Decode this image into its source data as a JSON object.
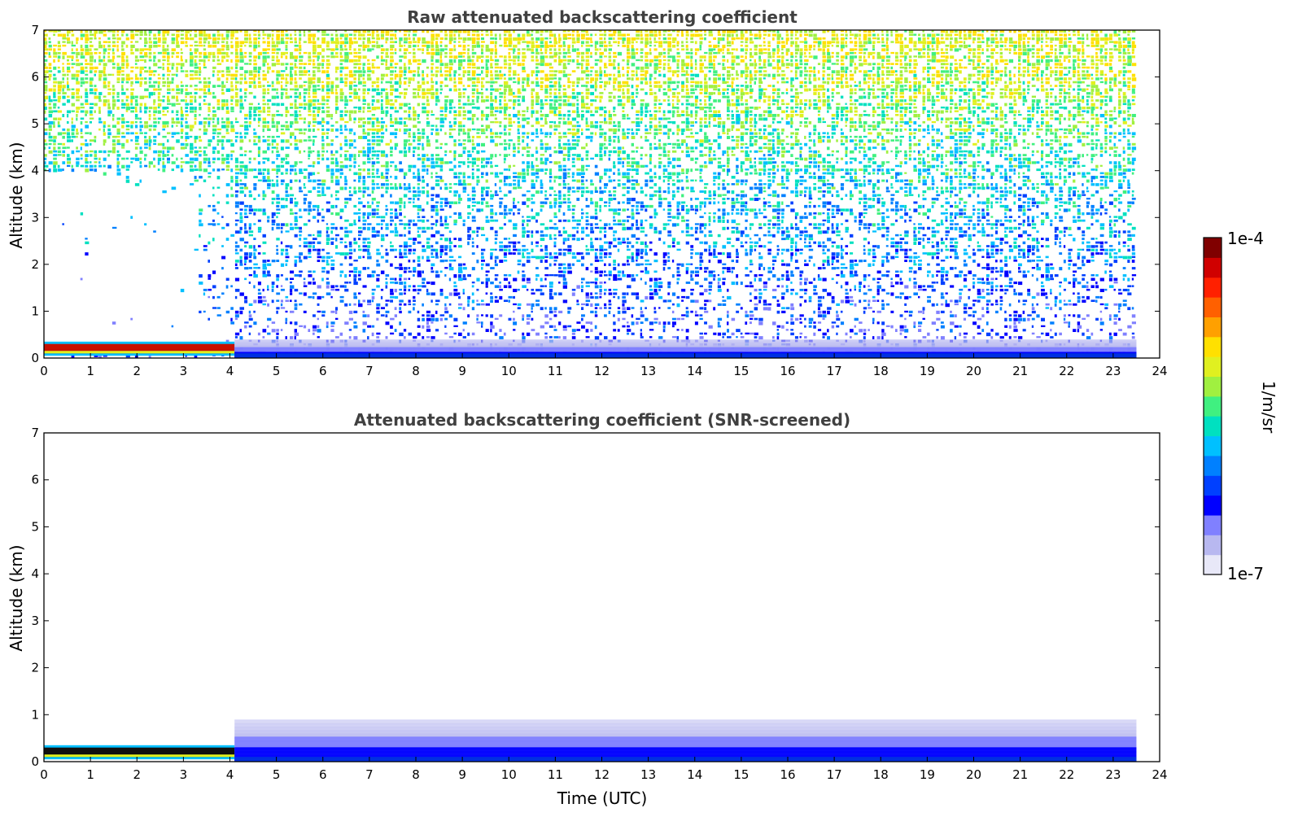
{
  "chart_data": [
    {
      "type": "heatmap",
      "title": "Raw attenuated backscattering coefficient",
      "xlabel": "",
      "ylabel": "Altitude (km)",
      "xlim": [
        0,
        24
      ],
      "ylim": [
        0,
        7
      ],
      "x_ticks": [
        "0",
        "1",
        "2",
        "3",
        "4",
        "5",
        "6",
        "7",
        "8",
        "9",
        "10",
        "11",
        "12",
        "13",
        "14",
        "15",
        "16",
        "17",
        "18",
        "19",
        "20",
        "21",
        "22",
        "23",
        "24"
      ],
      "y_ticks": [
        "0",
        "1",
        "2",
        "3",
        "4",
        "5",
        "6",
        "7"
      ],
      "data_extent_x": [
        0,
        23.5
      ],
      "features": [
        {
          "kind": "noise",
          "x": [
            0,
            23.5
          ],
          "y": [
            0,
            7
          ],
          "level": "increasing with altitude (blue to yellow-green near 6-7 km)"
        },
        {
          "kind": "cloud_layer",
          "x": [
            0,
            4.1
          ],
          "y": [
            0.1,
            0.3
          ],
          "level": "high (red)"
        },
        {
          "kind": "boundary_layer",
          "x": [
            4.1,
            23.5
          ],
          "y": [
            0,
            0.4
          ],
          "level": "moderate (blue)"
        },
        {
          "kind": "low_signal_region",
          "x": [
            0,
            4.1
          ],
          "y": [
            0.3,
            4.0
          ],
          "level": "blank"
        }
      ]
    },
    {
      "type": "heatmap",
      "title": "Attenuated backscattering coefficient (SNR-screened)",
      "xlabel": "Time (UTC)",
      "ylabel": "Altitude (km)",
      "xlim": [
        0,
        24
      ],
      "ylim": [
        0,
        7
      ],
      "x_ticks": [
        "0",
        "1",
        "2",
        "3",
        "4",
        "5",
        "6",
        "7",
        "8",
        "9",
        "10",
        "11",
        "12",
        "13",
        "14",
        "15",
        "16",
        "17",
        "18",
        "19",
        "20",
        "21",
        "22",
        "23",
        "24"
      ],
      "y_ticks": [
        "0",
        "1",
        "2",
        "3",
        "4",
        "5",
        "6",
        "7"
      ],
      "data_extent_x": [
        0,
        23.5
      ],
      "features": [
        {
          "kind": "cloud_layer",
          "x": [
            0,
            4.1
          ],
          "y": [
            0.1,
            0.3
          ],
          "level": "very high (black/red)"
        },
        {
          "kind": "boundary_layer",
          "x": [
            4.1,
            23.5
          ],
          "y": [
            0,
            0.9
          ],
          "level": "low-moderate (blue to pale blue)"
        }
      ]
    }
  ],
  "colorbar": {
    "min_label": "1e-7",
    "max_label": "1e-4",
    "label": "1/m/sr",
    "scale": "log",
    "colors": [
      "#e8e8f8",
      "#b8b8f0",
      "#8080ff",
      "#0000ff",
      "#0040ff",
      "#0080ff",
      "#00c0ff",
      "#00e0c0",
      "#40f080",
      "#a0f040",
      "#e0f020",
      "#ffe000",
      "#ffa000",
      "#ff6000",
      "#ff2000",
      "#d00000",
      "#800000"
    ]
  }
}
